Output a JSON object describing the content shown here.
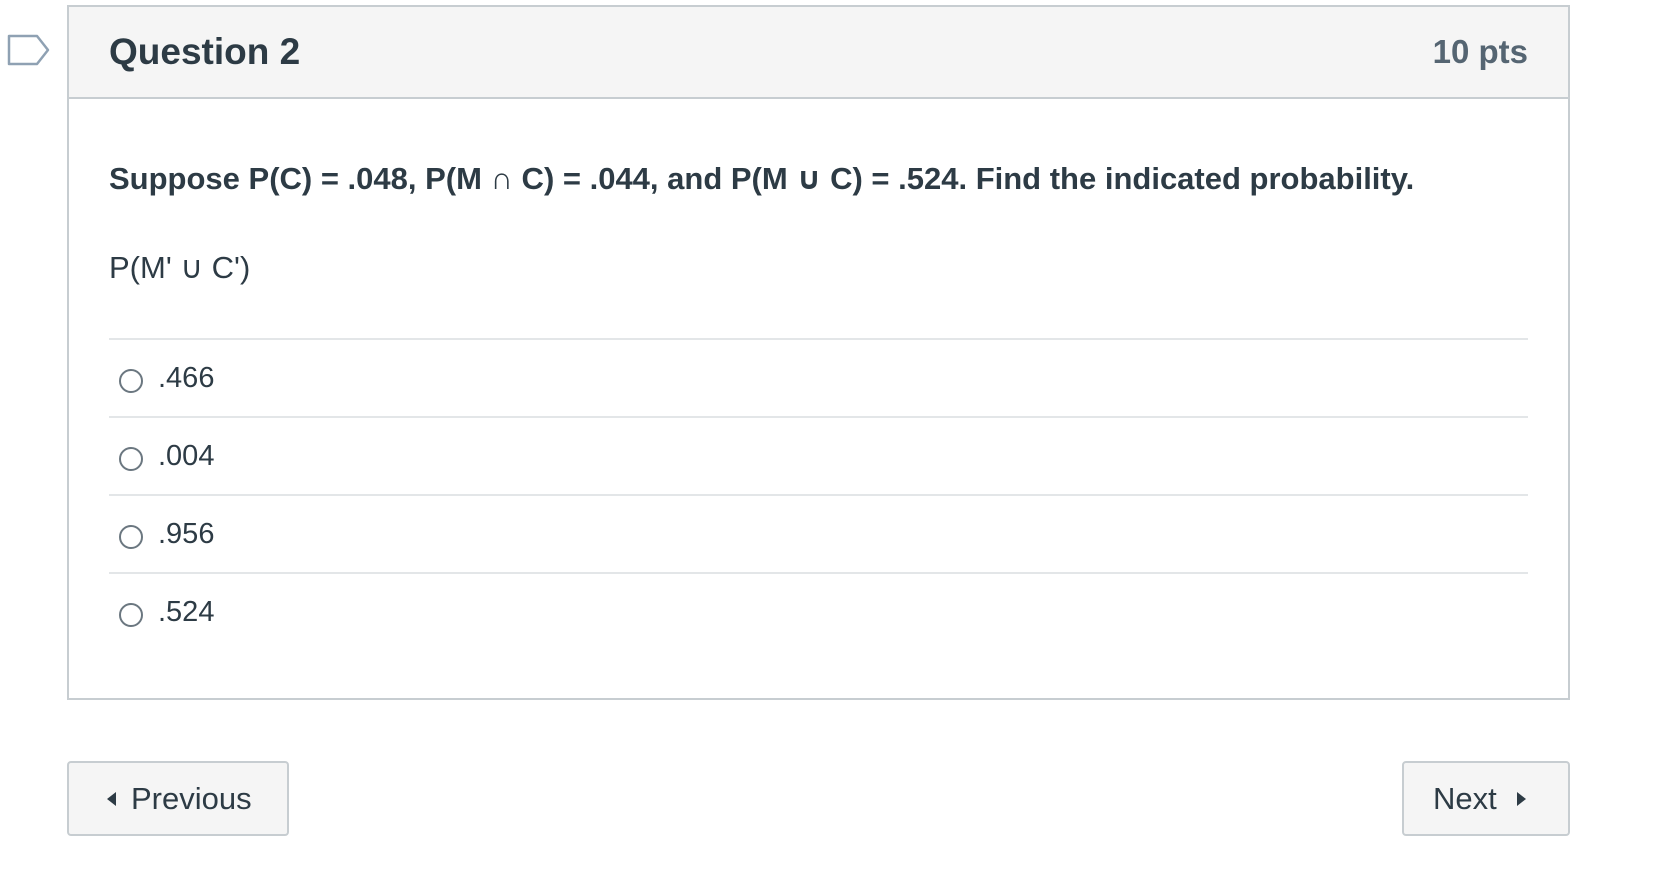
{
  "question": {
    "title": "Question 2",
    "points": "10 pts",
    "text": "Suppose P(C) = .048, P(M ∩ C) = .044, and P(M ∪ C) = .524. Find the indicated probability.",
    "expression": "P(M' ∪ C')",
    "answers": [
      {
        "label": ".466"
      },
      {
        "label": ".004"
      },
      {
        "label": ".956"
      },
      {
        "label": ".524"
      }
    ]
  },
  "navigation": {
    "previous_label": "Previous",
    "next_label": "Next"
  },
  "colors": {
    "header_bg": "#f5f5f5",
    "border": "#c7cdd1",
    "text": "#2d3b45",
    "flag": "#8fa1b3"
  },
  "icons": {
    "flag": "flag-question-icon",
    "radio": "radio-button-icon",
    "previous": "caret-left-icon",
    "next": "caret-right-icon"
  }
}
